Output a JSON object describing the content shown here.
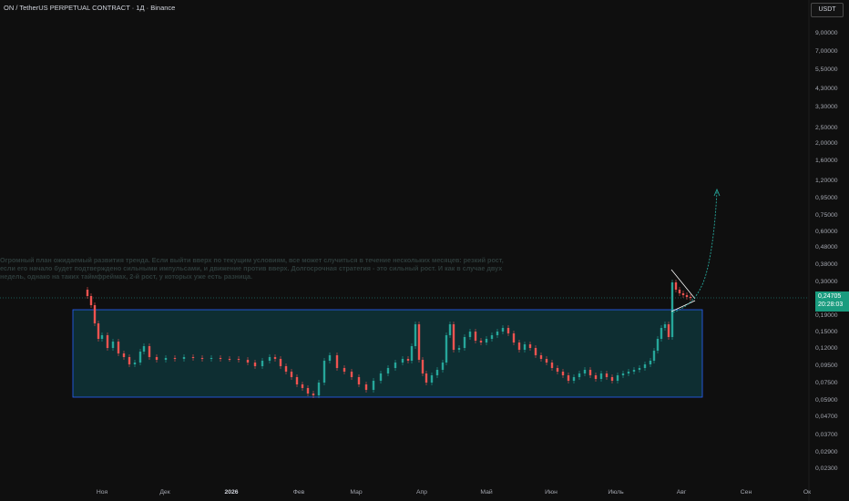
{
  "header": {
    "title": "ON / TetherUS PERPETUAL CONTRACT · 1Д · Binance",
    "currency": "USDT"
  },
  "annotation": {
    "text": "Огромный план ожидаемый развития тренда. Если выйти вверх по текущим условиям, все может случиться в течение нескольких месяцев: резкий рост, если его начало будет подтверждено сильными импульсами, и движение против вверх. Долгосрочная стратегия - это сильный рост. И как в случае двух недель, однако на таких таймфреймах, 2-й рост, у которых уже есть разница."
  },
  "price_axis": {
    "labels": [
      "9,00000",
      "7,00000",
      "5,50000",
      "4,30000",
      "3,30000",
      "2,50000",
      "2,00000",
      "1,60000",
      "1,20000",
      "0,95000",
      "0,75000",
      "0,60000",
      "0,48000",
      "0,38000",
      "0,30000",
      "0,19000",
      "0,15000",
      "0,12000",
      "0,09500",
      "0,07500",
      "0,05900",
      "0,04700",
      "0,03700",
      "0,02900",
      "0,02300"
    ]
  },
  "time_axis": {
    "labels": [
      "Ноя",
      "Дек",
      "2026",
      "Фев",
      "Мар",
      "Апр",
      "Май",
      "Июн",
      "Июль",
      "Авг",
      "Сен",
      "Ок"
    ]
  },
  "current_price": {
    "price": "0,24705",
    "countdown": "20:28:03"
  },
  "colors": {
    "background": "#0f0f0f",
    "up": "#26a69a",
    "down": "#ef5350",
    "range_fill": "#0f3a3f",
    "range_border": "#2962ff",
    "badge": "#1a9c7f"
  }
}
